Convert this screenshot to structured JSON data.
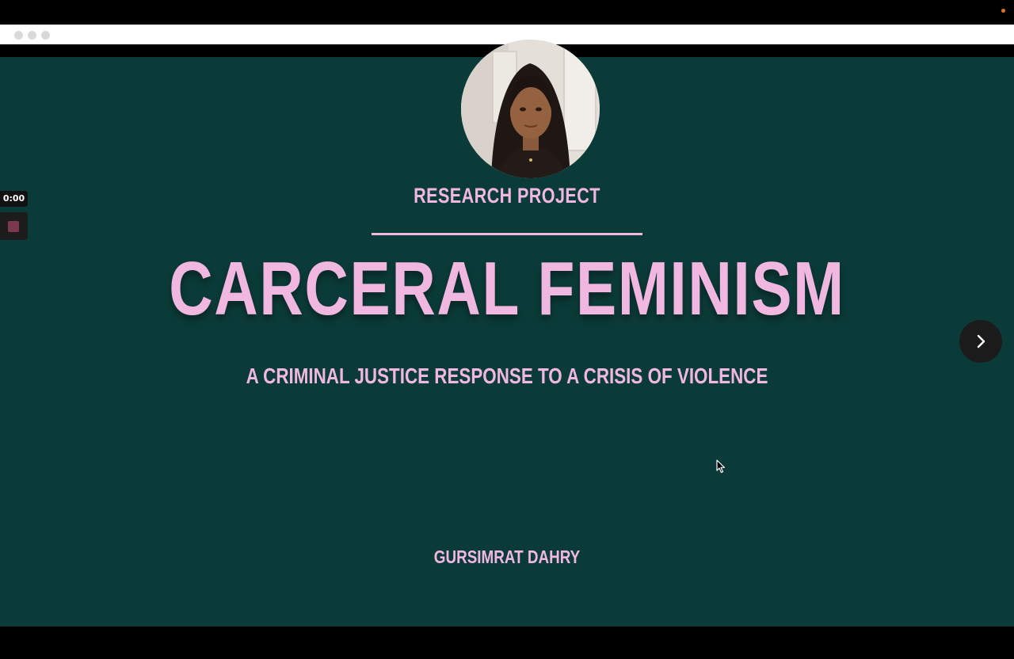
{
  "recorder": {
    "timer": "0:00"
  },
  "slide": {
    "eyebrow": "RESEARCH PROJECT",
    "title": "CARCERAL FEMINISM",
    "subtitle": "A CRIMINAL JUSTICE RESPONSE TO A CRISIS OF VIOLENCE",
    "author": "GURSIMRAT DAHRY"
  },
  "icons": {
    "next": "chevron-right-icon",
    "stop": "stop-icon",
    "cursor": "mouse-pointer-icon"
  },
  "colors": {
    "slide_background": "#0b3b38",
    "text_pink": "#f0b8e0",
    "recording_dot": "#e8701f",
    "stop_button": "#7b3a4b"
  }
}
